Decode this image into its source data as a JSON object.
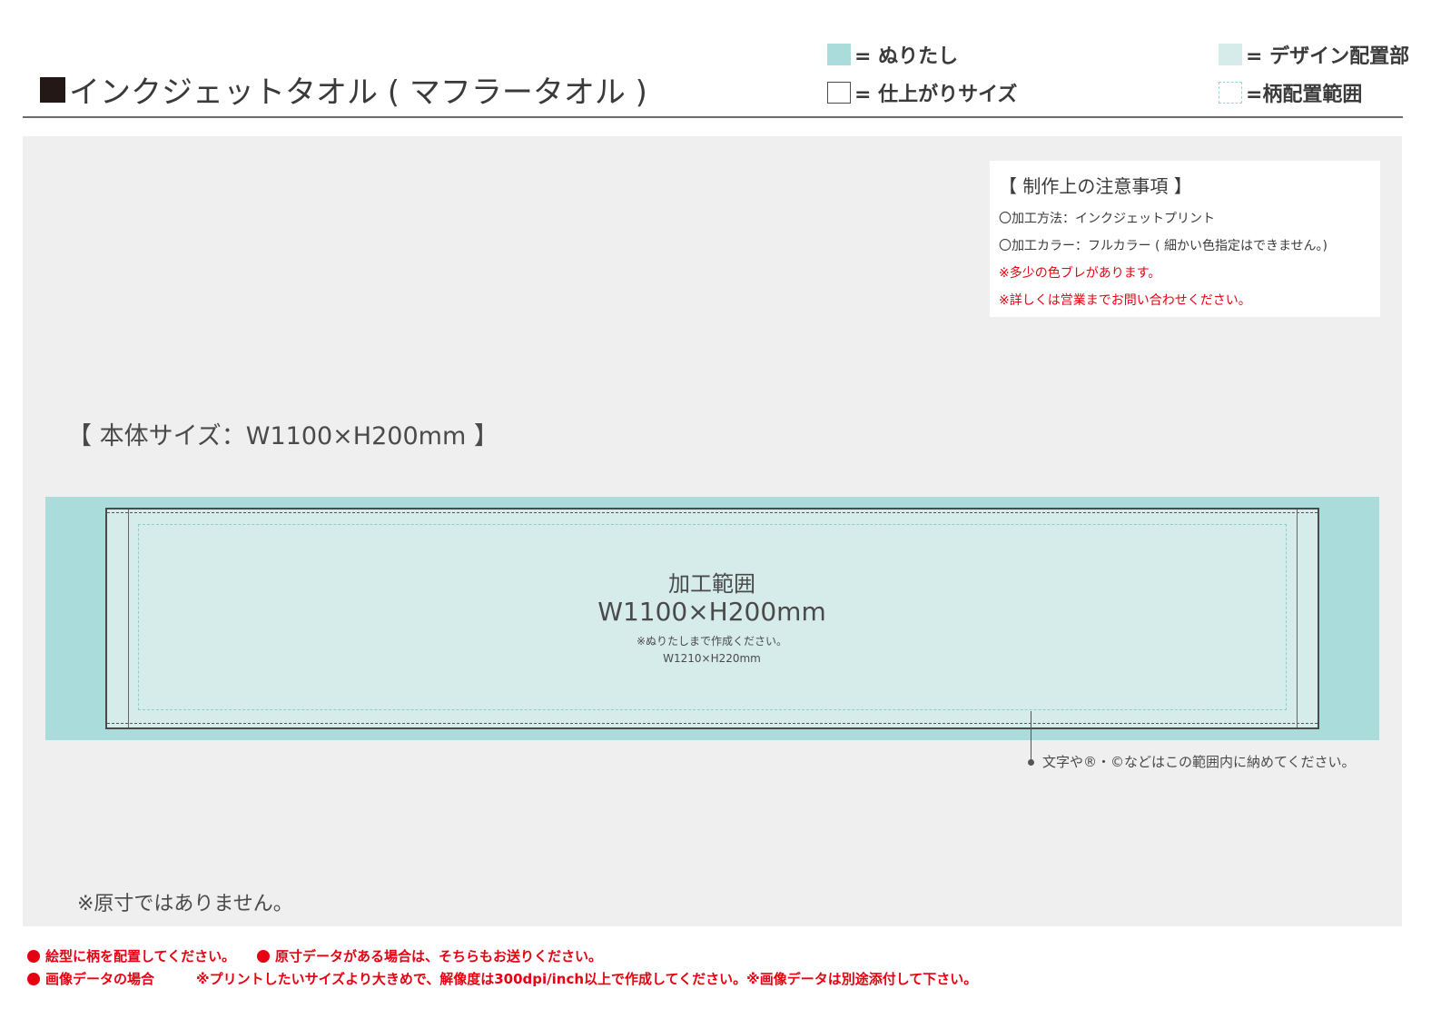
{
  "header": {
    "title": "インクジェットタオル ( マフラータオル )",
    "legend": {
      "bleed": "= ぬりたし",
      "finish_size": "= 仕上がりサイズ",
      "design_area": "= デザイン配置部",
      "pattern_area": "=柄配置範囲"
    }
  },
  "notes": {
    "title": "【 制作上の注意事項 】",
    "method": "〇加工方法：インクジェットプリント",
    "color": "〇加工カラー：フルカラー ( 細かい色指定はできません。)",
    "warning1": "※多少の色ブレがあります。",
    "warning2": "※詳しくは営業までお問い合わせください。"
  },
  "main": {
    "body_size": "【 本体サイズ：W1100×H200mm 】",
    "area_label": "加工範囲",
    "area_size": "W1100×H200mm",
    "bleed_note": "※ぬりたしまで作成ください。",
    "bleed_size": "W1210×H220mm",
    "callout": "文字や®・©などはこの範囲内に納めてください。",
    "not_actual_size": "※原寸ではありません。"
  },
  "footer": {
    "note1": "絵型に柄を配置してください。",
    "note2": "原寸データがある場合は、そちらもお送りください。",
    "note3": "画像データの場合",
    "note4": "※プリントしたいサイズより大きめで、解像度は300dpi/inch以上で作成してください。※画像データは別途添付して下さい。"
  },
  "colors": {
    "bleed": "#a9dcda",
    "design_area": "#d6ecea",
    "panel": "#eeefee",
    "warning": "#e60012"
  }
}
